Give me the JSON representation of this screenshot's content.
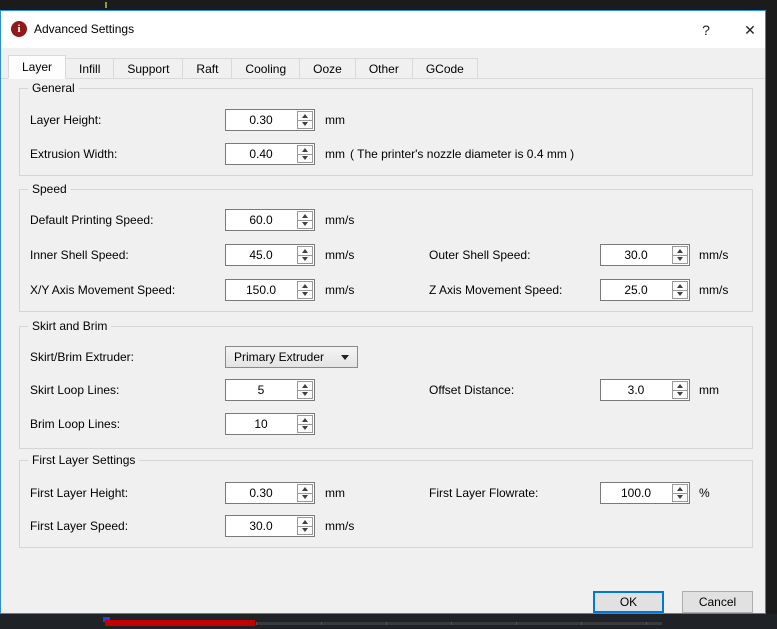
{
  "colors": {
    "dialog_border": "#2a8fd8",
    "dialog_bg": "#f0f0f0",
    "titlebar_bg": "#ffffff",
    "ok_focus_border": "#0078d7",
    "app_icon_red": "#8f1a1c",
    "background_progress_red": "#c40000"
  },
  "window": {
    "title": "Advanced Settings",
    "icon_glyph": "i",
    "help": "?",
    "close": "✕"
  },
  "tabs": [
    {
      "label": "Layer"
    },
    {
      "label": "Infill"
    },
    {
      "label": "Support"
    },
    {
      "label": "Raft"
    },
    {
      "label": "Cooling"
    },
    {
      "label": "Ooze"
    },
    {
      "label": "Other"
    },
    {
      "label": "GCode"
    }
  ],
  "active_tab": "Layer",
  "sections": {
    "general": {
      "title": "General",
      "layer_height": {
        "label": "Layer Height:",
        "value": "0.30",
        "unit": "mm"
      },
      "extrusion_width": {
        "label": "Extrusion Width:",
        "value": "0.40",
        "unit": "mm",
        "note": "( The printer's nozzle diameter is 0.4 mm )"
      }
    },
    "speed": {
      "title": "Speed",
      "default_printing": {
        "label": "Default Printing Speed:",
        "value": "60.0",
        "unit": "mm/s"
      },
      "inner_shell": {
        "label": "Inner Shell Speed:",
        "value": "45.0",
        "unit": "mm/s"
      },
      "outer_shell": {
        "label": "Outer Shell Speed:",
        "value": "30.0",
        "unit": "mm/s"
      },
      "xy_movement": {
        "label": "X/Y Axis Movement Speed:",
        "value": "150.0",
        "unit": "mm/s"
      },
      "z_movement": {
        "label": "Z Axis Movement Speed:",
        "value": "25.0",
        "unit": "mm/s"
      }
    },
    "skirt_brim": {
      "title": "Skirt and Brim",
      "extruder": {
        "label": "Skirt/Brim Extruder:",
        "value": "Primary Extruder"
      },
      "skirt_loops": {
        "label": "Skirt Loop Lines:",
        "value": "5"
      },
      "offset_distance": {
        "label": "Offset Distance:",
        "value": "3.0",
        "unit": "mm"
      },
      "brim_loops": {
        "label": "Brim Loop Lines:",
        "value": "10"
      }
    },
    "first_layer": {
      "title": "First Layer Settings",
      "height": {
        "label": "First Layer Height:",
        "value": "0.30",
        "unit": "mm"
      },
      "flowrate": {
        "label": "First Layer Flowrate:",
        "value": "100.0",
        "unit": "%"
      },
      "speed": {
        "label": "First Layer Speed:",
        "value": "30.0",
        "unit": "mm/s"
      }
    }
  },
  "buttons": {
    "ok": "OK",
    "cancel": "Cancel"
  }
}
